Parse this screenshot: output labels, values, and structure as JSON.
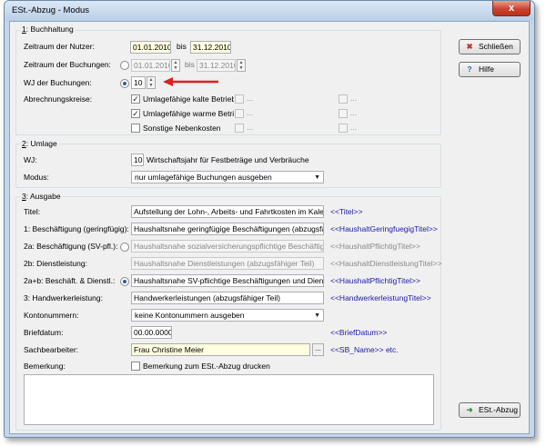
{
  "window": {
    "title": "ESt.-Abzug - Modus",
    "close_glyph": "x"
  },
  "buttons": {
    "schliessen": "Schließen",
    "hilfe": "Hilfe",
    "est_abzug": "ESt.-Abzug"
  },
  "buchhaltung": {
    "group_num": "1",
    "group_rest": ": Buchhaltung",
    "zeitraum_nutzer_label": "Zeitraum der Nutzer:",
    "nutzer_from": "01.01.2010",
    "bis1": "bis",
    "nutzer_to": "31.12.2010",
    "zeitraum_buchungen_label": "Zeitraum der Buchungen:",
    "buchungen_from": "01.01.2010",
    "bis2": "bis",
    "buchungen_to": "31.12.2010",
    "wj_label": "WJ der Buchungen:",
    "wj_value": "10",
    "abrechnungskreise_label": "Abrechnungskreise:",
    "kreise": [
      {
        "label": "Umlagefähige kalte Betriebs",
        "checked": true
      },
      {
        "label": "Umlagefähige warme Betrie",
        "checked": true
      },
      {
        "label": "Sonstige Nebenkosten",
        "checked": false
      }
    ],
    "dots_label": "...",
    "arrow_color": "#e02020"
  },
  "umlage": {
    "group_num": "2",
    "group_rest": ": Umlage",
    "wj_label": "WJ:",
    "wj_value": "10",
    "wj_note": "Wirtschaftsjahr für Festbeträge und Verbräuche",
    "modus_label": "Modus:",
    "modus_value": "nur umlagefähige Buchungen ausgeben"
  },
  "ausgabe": {
    "group_num": "3",
    "group_rest": ": Ausgabe",
    "titel_label": "Titel:",
    "titel_value": "Aufstellung der Lohn-, Arbeits- und Fahrtkosten im Kalenderj",
    "titel_tok": "<<Titel>>",
    "geringfuegig_label": "1: Beschäftigung (geringfügig):",
    "geringfuegig_value": "Haushaltsnahe geringfügige Beschäftigungen (abzugsfähige",
    "geringfuegig_tok": "<<HaushaltGeringfuegigTitel>>",
    "svpfl_label": "2a: Beschäftigung (SV-pfl.):",
    "svpfl_value": "Haushaltsnahe sozialversicherungspflichtige Beschäftigunge",
    "svpfl_tok": "<<HaushaltPflichtigTitel>>",
    "dienst_label": "2b: Dienstleistung:",
    "dienst_value": "Haushaltsnahe Dienstleistungen (abzugsfähiger Teil)",
    "dienst_tok": "<<HaushaltDienstleistungTitel>>",
    "beschdienst_label": "2a+b: Beschäft. & Dienstl.:",
    "beschdienst_value": "Haushaltsnahe SV-pflichtige Beschäftigungen und Dienstlei",
    "beschdienst_tok": "<<HaushaltPflichtigTitel>>",
    "handwerk_label": "3: Handwerkerleistung:",
    "handwerk_value": "Handwerkerleistungen (abzugsfähiger Teil)",
    "handwerk_tok": "<<HandwerkerleistungTitel>>",
    "konto_label": "Kontonummern:",
    "konto_value": "keine Kontonummern ausgeben",
    "brief_label": "Briefdatum:",
    "brief_value": "00.00.0000",
    "brief_tok": "<<BriefDatum>>",
    "sach_label": "Sachbearbeiter:",
    "sach_value": "Frau Christine Meier",
    "sach_tok": "<<SB_Name>> etc.",
    "bem_label": "Bemerkung:",
    "bem_check": "Bemerkung zum ESt.-Abzug drucken",
    "bem_text": ""
  },
  "colors": {
    "token": "#1a1aa8",
    "highlight": "#ffffe1",
    "titlebar": "#c4d6ea"
  }
}
